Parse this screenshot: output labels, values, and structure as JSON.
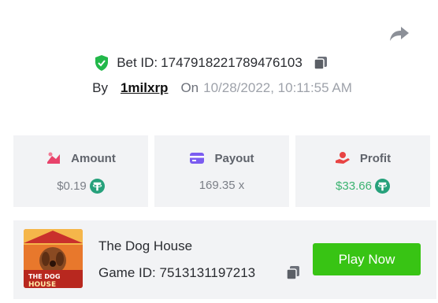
{
  "bet": {
    "id_label": "Bet ID:",
    "id_value": "1747918221789476103",
    "by_label": "By",
    "username": "1milxrp",
    "on_label": "On",
    "datetime": "10/28/2022, 10:11:55 AM"
  },
  "stats": [
    {
      "title": "Amount",
      "value": "$0.19",
      "icon": "amount-icon",
      "currency_icon": "tether-icon"
    },
    {
      "title": "Payout",
      "value": "169.35 x",
      "icon": "payout-card-icon"
    },
    {
      "title": "Profit",
      "value": "$33.66",
      "icon": "profit-hand-icon",
      "currency_icon": "tether-icon"
    }
  ],
  "game": {
    "name": "The Dog House",
    "id_label": "Game ID:",
    "id_value": "7513131197213",
    "thumb_text": [
      "THE DOG",
      "HOUSE"
    ],
    "play_label": "Play Now"
  },
  "colors": {
    "accent_green": "#38c414",
    "profit_green": "#3cb371",
    "card_bg": "#f2f3f5",
    "shield_green": "#22b84a",
    "payout_purple": "#7b5cf0",
    "amount_pink": "#e8436b"
  }
}
